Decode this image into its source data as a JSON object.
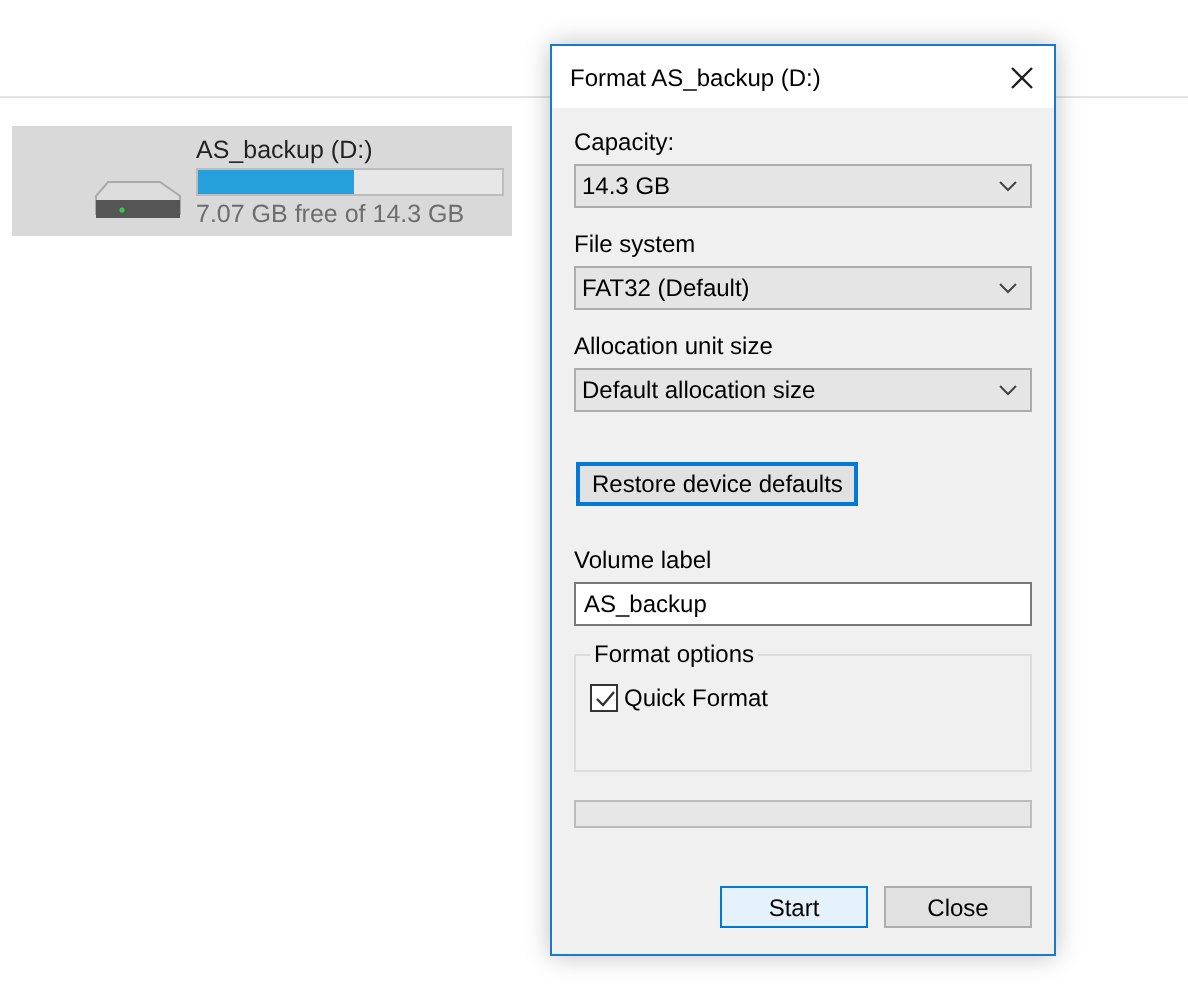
{
  "drive": {
    "name": "AS_backup (D:)",
    "level": 0.51,
    "free_text": "7.07 GB free of 14.3 GB",
    "selected": true
  },
  "dialog": {
    "title": "Format AS_backup (D:)",
    "fields": [
      {
        "label": "Capacity:",
        "value": "14.3 GB"
      },
      {
        "label": "File system",
        "value": "FAT32 (Default)"
      },
      {
        "label": "Allocation unit size",
        "value": "Default allocation size"
      }
    ],
    "restore_button": "Restore device defaults",
    "volume_label": {
      "label": "Volume label",
      "value": "AS_backup"
    },
    "format_options": {
      "title": "Format options",
      "quick_format": {
        "label": "Quick Format",
        "checked": true
      }
    },
    "progress": {
      "level": 0
    },
    "buttons": [
      {
        "label": "Start",
        "default": true
      },
      {
        "label": "Close",
        "default": false
      }
    ]
  }
}
